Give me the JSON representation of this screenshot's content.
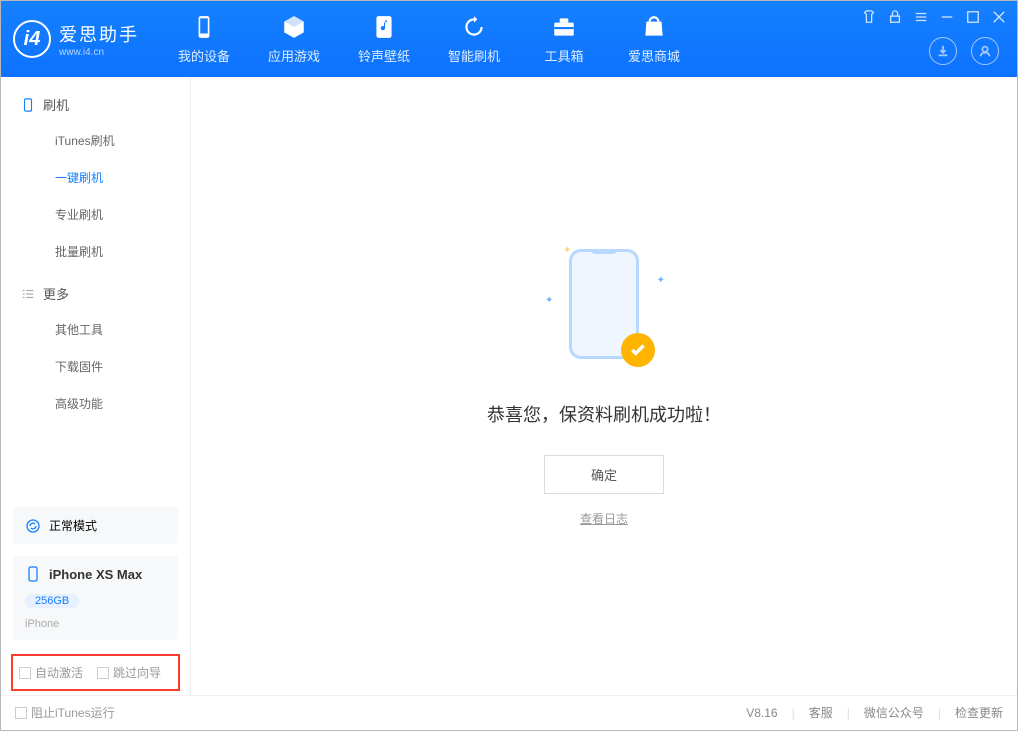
{
  "app": {
    "name": "爱思助手",
    "url": "www.i4.cn"
  },
  "nav": {
    "tabs": [
      {
        "label": "我的设备",
        "icon": "phone"
      },
      {
        "label": "应用游戏",
        "icon": "cube"
      },
      {
        "label": "铃声壁纸",
        "icon": "music"
      },
      {
        "label": "智能刷机",
        "icon": "refresh"
      },
      {
        "label": "工具箱",
        "icon": "toolbox"
      },
      {
        "label": "爱思商城",
        "icon": "bag"
      }
    ]
  },
  "sidebar": {
    "group1": {
      "title": "刷机"
    },
    "items1": [
      {
        "label": "iTunes刷机"
      },
      {
        "label": "一键刷机"
      },
      {
        "label": "专业刷机"
      },
      {
        "label": "批量刷机"
      }
    ],
    "group2": {
      "title": "更多"
    },
    "items2": [
      {
        "label": "其他工具"
      },
      {
        "label": "下载固件"
      },
      {
        "label": "高级功能"
      }
    ],
    "mode": "正常模式",
    "device": {
      "name": "iPhone XS Max",
      "storage": "256GB",
      "type": "iPhone"
    },
    "opts": {
      "auto_activate": "自动激活",
      "skip_guide": "跳过向导"
    }
  },
  "main": {
    "success_text": "恭喜您，保资料刷机成功啦！",
    "ok_button": "确定",
    "view_log": "查看日志"
  },
  "footer": {
    "block_itunes": "阻止iTunes运行",
    "version": "V8.16",
    "links": {
      "support": "客服",
      "wechat": "微信公众号",
      "update": "检查更新"
    }
  }
}
